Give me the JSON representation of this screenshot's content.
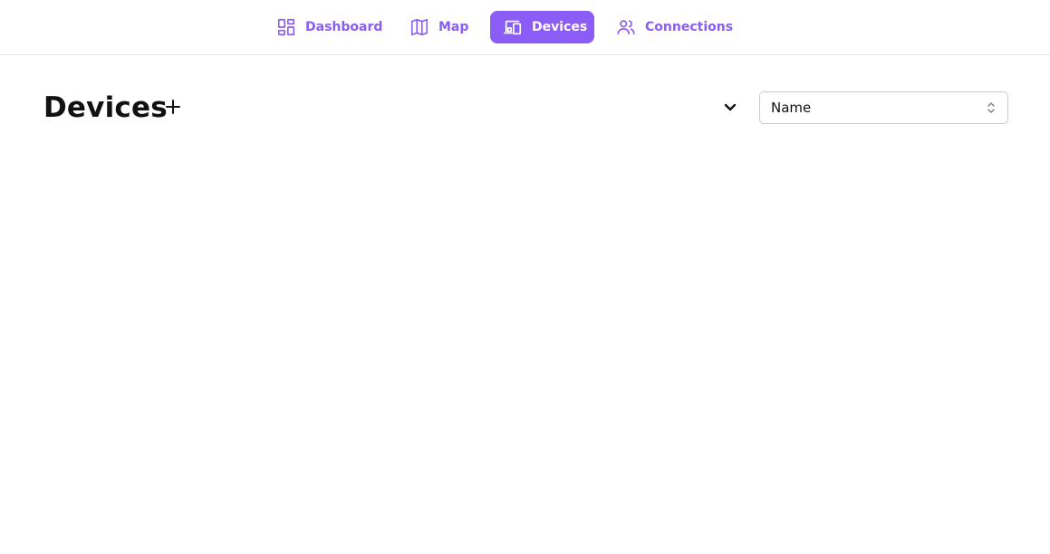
{
  "nav": {
    "items": [
      {
        "label": "Dashboard",
        "icon": "dashboard-icon"
      },
      {
        "label": "Map",
        "icon": "map-icon"
      },
      {
        "label": "Devices",
        "icon": "devices-icon",
        "active": true
      },
      {
        "label": "Connections",
        "icon": "users-icon"
      }
    ]
  },
  "page": {
    "title": "Devices"
  },
  "sort": {
    "selected": "Name"
  },
  "colors": {
    "accent": "#8b5cf6",
    "text": "#111111",
    "border": "#c9c9cf"
  }
}
